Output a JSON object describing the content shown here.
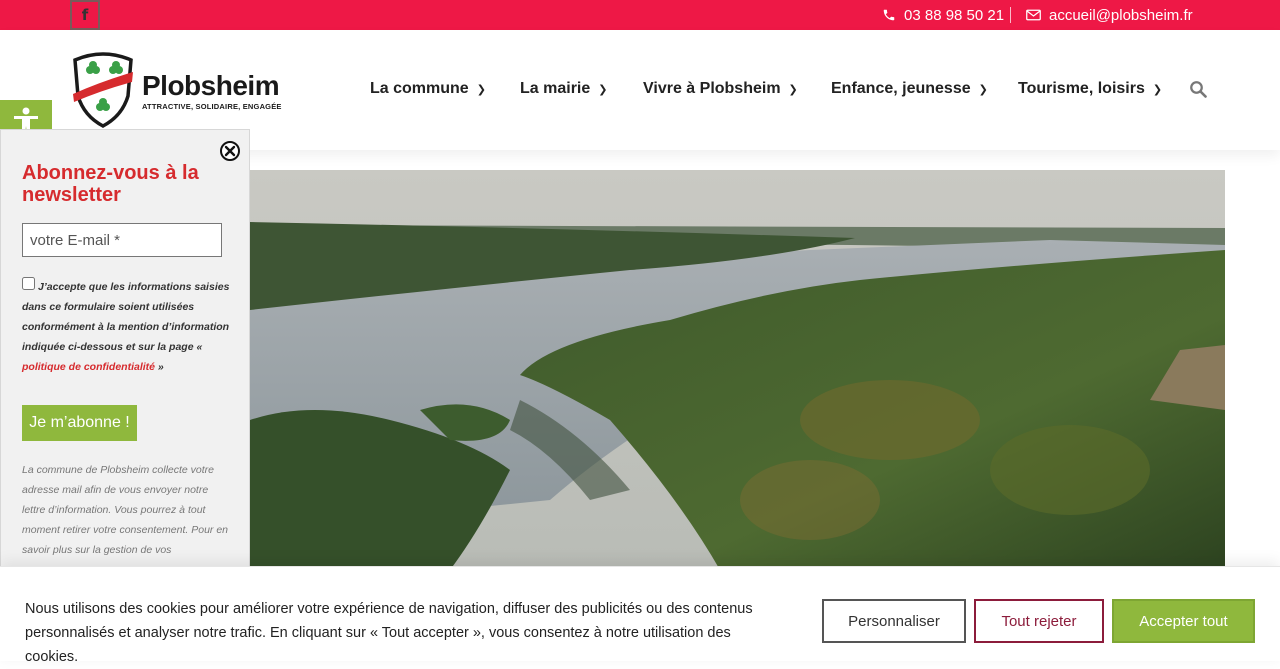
{
  "topbar": {
    "facebook_icon": "facebook-icon",
    "phone": "03 88 98 50 21",
    "email": "accueil@plobsheim.fr",
    "color": "#ee1846"
  },
  "logo": {
    "name": "Plobsheim",
    "tagline": "ATTRACTIVE, SOLIDAIRE, ENGAGÉE"
  },
  "nav": {
    "items": [
      {
        "label": "La commune"
      },
      {
        "label": "La mairie"
      },
      {
        "label": "Vivre à Plobsheim"
      },
      {
        "label": "Enfance, jeunesse"
      },
      {
        "label": "Tourisme, loisirs"
      }
    ]
  },
  "newsletter": {
    "title": "Abonnez-vous à la newsletter",
    "email_placeholder": "votre E-mail *",
    "consent_text": "J’accepte que les informations saisies dans ce formulaire soient utilisées conformément à la mention d’information indiquée ci-dessous et sur la page «",
    "consent_link": "politique de confidentialité",
    "consent_end": " »",
    "submit_label": "Je m’abonne !",
    "legal_text": "La commune de Plobsheim collecte votre adresse mail afin de vous envoyer notre lettre d’information. Vous pourrez à tout moment retirer votre consentement. Pour en savoir plus sur la gestion de vos"
  },
  "cookie": {
    "text": "Nous utilisons des cookies pour améliorer votre expérience de navigation, diffuser des publicités ou des contenus personnalisés et analyser notre trafic. En cliquant sur « Tout accepter », vous consentez à notre utilisation des cookies.",
    "customize_label": "Personnaliser",
    "reject_label": "Tout rejeter",
    "accept_label": "Accepter tout"
  },
  "colors": {
    "brand_red": "#ee1846",
    "accent_green": "#8fb83d",
    "title_red": "#d62b2e",
    "reject_border": "#8c1c3b"
  }
}
